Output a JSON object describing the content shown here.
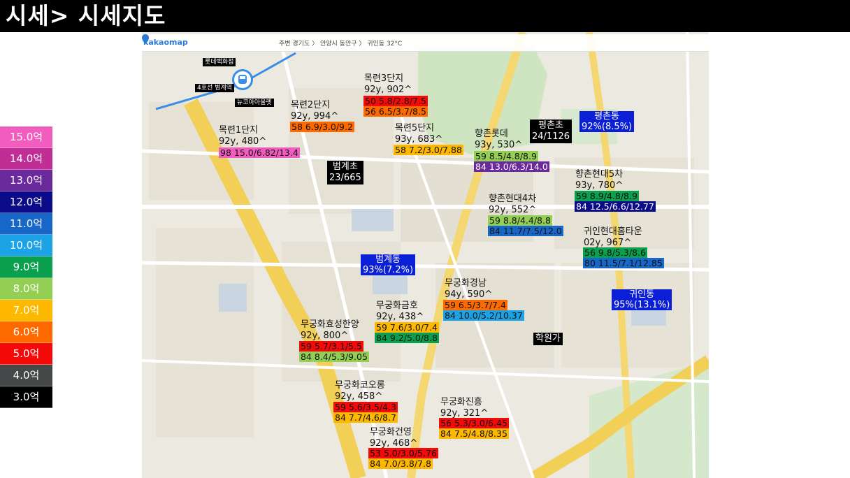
{
  "title": "시세> 시세지도",
  "legend": [
    {
      "label": "15.0억",
      "color": "#f25cbf"
    },
    {
      "label": "14.0억",
      "color": "#bf2d95"
    },
    {
      "label": "13.0억",
      "color": "#6a2a9c"
    },
    {
      "label": "12.0억",
      "color": "#0c0c8a"
    },
    {
      "label": "11.0억",
      "color": "#1767c9"
    },
    {
      "label": "10.0억",
      "color": "#1ba3e6"
    },
    {
      "label": "9.0억",
      "color": "#0aa04d"
    },
    {
      "label": "8.0억",
      "color": "#93cf52"
    },
    {
      "label": "7.0억",
      "color": "#ffb800"
    },
    {
      "label": "6.0억",
      "color": "#ff6a00"
    },
    {
      "label": "5.0억",
      "color": "#f50a0a"
    },
    {
      "label": "4.0억",
      "color": "#444848"
    },
    {
      "label": "3.0억",
      "color": "#000000"
    }
  ],
  "map": {
    "logo": "kakaomap",
    "topbar": "주변   경기도  〉 안양시 동안구  〉 귀인동     32°C",
    "pins": {
      "lotte": "롯데백화점",
      "line4": "4호선 범계역",
      "newcore": "뉴코아아울렛"
    },
    "schools": [
      {
        "name": "범계초",
        "count": "23/665"
      },
      {
        "name": "평촌초",
        "count": "24/1126"
      }
    ],
    "stats": {
      "pyeongchon": "평촌동",
      "pyeongchon_rate": "92%(8.5%)",
      "beomgye": "범계동",
      "beomgye_rate": "93%(7.2%)",
      "gwiin": "귀인동",
      "gwiin_rate": "95%(13.1%)"
    },
    "academy": "학원가",
    "apts": {
      "mokryeon1": {
        "name": "목련1단지",
        "year": "92y, 480^",
        "rows": [
          "98 15.0/6.82/13.4"
        ]
      },
      "mokryeon2": {
        "name": "목련2단지",
        "year": "92y, 994^",
        "rows": [
          "58 6.9/3.0/9.2"
        ]
      },
      "mokryeon3": {
        "name": "목련3단지",
        "year": "92y, 902^",
        "rows": [
          "50 5.8/2.8/7.5",
          "56 6.5/3.7/8.5"
        ]
      },
      "mokryeon5": {
        "name": "목련5단지",
        "year": "93y, 683^",
        "rows": [
          "58 7.2/3.0/7.88"
        ]
      },
      "hyangchon_lotte": {
        "name": "향촌롯데",
        "year": "93y, 530^",
        "rows": [
          "59 8.5/4.8/8.9",
          "84 13.0/6.3/14.0"
        ]
      },
      "hyangchon5": {
        "name": "향촌현대5차",
        "year": "93y, 780^",
        "rows": [
          "59 8.9/4.8/8.9",
          "84 12.5/6.6/12.77"
        ]
      },
      "hyangchon4": {
        "name": "향촌현대4차",
        "year": "92y, 552^",
        "rows": [
          "59 8.8/4.4/8.8",
          "84 11.7/7.5/12.0"
        ]
      },
      "gwiin_hometown": {
        "name": "귀인현대홈타운",
        "year": "02y, 967^",
        "rows": [
          "56 9.8/5.3/8.6",
          "80 11.5/7.1/12.85"
        ]
      },
      "mugung_gyeongnam": {
        "name": "무궁화경남",
        "year": "94y, 590^",
        "rows": [
          "59 6.5/3.7/7.4",
          "84 10.0/5.2/10.37"
        ]
      },
      "mugung_geumho": {
        "name": "무궁화금호",
        "year": "92y, 438^",
        "rows": [
          "59 7.6/3.0/7.4",
          "84 9.2/5.0/8.8"
        ]
      },
      "mugung_hyosung": {
        "name": "무궁화효성한양",
        "year": "92y, 800^",
        "rows": [
          "59 5.7/3.1/5.5",
          "84 8.4/5.3/9.05"
        ]
      },
      "mugung_kolon": {
        "name": "무궁화코오롱",
        "year": "92y, 458^",
        "rows": [
          "59 5.6/3.5/4.3",
          "84 7.7/4.6/8.7"
        ]
      },
      "mugung_jinheung": {
        "name": "무궁화진흥",
        "year": "92y, 321^",
        "rows": [
          "56 5.3/3.0/6.45",
          "84 7.5/4.8/8.35"
        ]
      },
      "mugung_geonyoung": {
        "name": "무궁화건영",
        "year": "92y, 468^",
        "rows": [
          "53 5.0/3.0/5.76",
          "84 7.0/3.8/7.8"
        ]
      }
    }
  }
}
